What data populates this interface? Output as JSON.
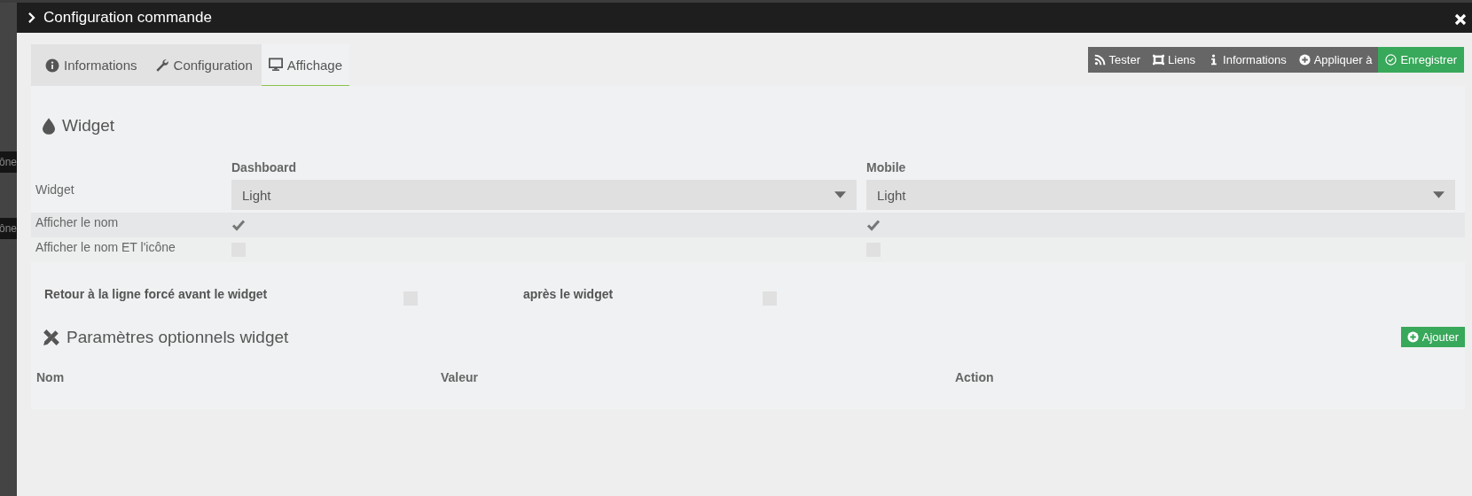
{
  "backdrop": {
    "fragments": [
      "ône",
      "ône"
    ]
  },
  "window": {
    "title": "Configuration commande"
  },
  "tabs": [
    {
      "label": "Informations",
      "selected": false
    },
    {
      "label": "Configuration",
      "selected": false
    },
    {
      "label": "Affichage",
      "selected": true
    }
  ],
  "actions": [
    {
      "label": "Tester",
      "kind": "default"
    },
    {
      "label": "Liens",
      "kind": "default"
    },
    {
      "label": "Informations",
      "kind": "default"
    },
    {
      "label": "Appliquer à",
      "kind": "default"
    },
    {
      "label": "Enregistrer",
      "kind": "primary"
    }
  ],
  "widget_section": {
    "title": "Widget",
    "columns": [
      "Dashboard",
      "Mobile"
    ],
    "rows": [
      {
        "label": "Widget",
        "kind": "select",
        "cells": [
          {
            "value": "Light"
          },
          {
            "value": "Light"
          }
        ]
      },
      {
        "label": "Afficher le nom",
        "kind": "checkbox",
        "cells": [
          {
            "checked": true
          },
          {
            "checked": true
          }
        ]
      },
      {
        "label": "Afficher le nom ET l'icône",
        "kind": "checkbox",
        "cells": [
          {
            "checked": false
          },
          {
            "checked": false
          }
        ]
      }
    ]
  },
  "line_breaks": [
    {
      "label": "Retour à la ligne forcé avant le widget",
      "checked": false
    },
    {
      "label": "après le widget",
      "checked": false
    }
  ],
  "optional_params": {
    "title": "Paramètres optionnels widget",
    "add_button": "Ajouter",
    "columns": [
      "Nom",
      "Valeur",
      "Action"
    ]
  }
}
